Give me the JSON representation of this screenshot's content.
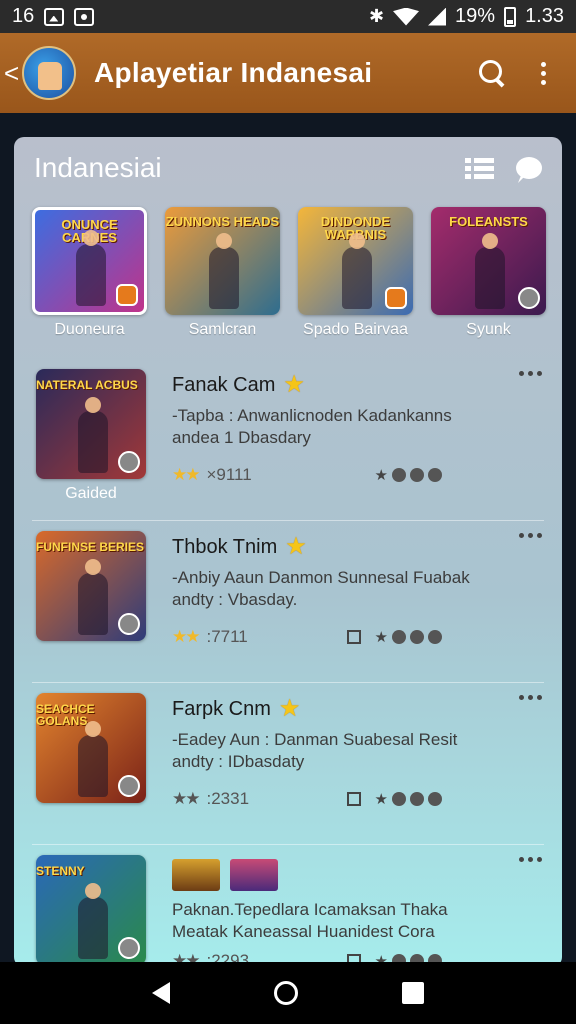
{
  "status_bar": {
    "time_left": "16",
    "battery_pct": "19%",
    "clock": "1.33"
  },
  "app_bar": {
    "back_glyph": "<",
    "title": "Aplayetiar Indanesai",
    "search_icon": "search-icon",
    "menu_icon": "more-vert-icon"
  },
  "section": {
    "title": "Indanesiai",
    "list_view_icon": "list-view-icon",
    "chat_icon": "chat-icon"
  },
  "featured": [
    {
      "label": "Duoneura",
      "thumb_title": "ONUNCE CARNES",
      "colors": [
        "#3d6de0",
        "#c0338a"
      ],
      "selected": true,
      "badge": "orange"
    },
    {
      "label": "Samlcran",
      "thumb_title": "ZUNNONS HEADS",
      "colors": [
        "#ec9b3b",
        "#2e6d8f"
      ],
      "selected": false,
      "badge": ""
    },
    {
      "label": "Spado Bairvaa",
      "thumb_title": "DINDONDE WARBNIS",
      "colors": [
        "#f4b63a",
        "#3b6bb3"
      ],
      "selected": false,
      "badge": "orange"
    },
    {
      "label": "Syunk",
      "thumb_title": "FOLEANSTS",
      "colors": [
        "#a42c6c",
        "#3b1a4e"
      ],
      "selected": false,
      "badge": "grey"
    }
  ],
  "items": [
    {
      "title": "Fanak Cam",
      "desc_line1": "-Tapba : Anwanlicnoden Kadankanns",
      "desc_line2": "andea 1 Dbasdary",
      "count": "×9111",
      "stars": "★★",
      "stars_style": "gold",
      "thumb_title": "NATERAL ACBUS",
      "caption": "Gaided",
      "colors": [
        "#2a2a5a",
        "#a23838"
      ],
      "checkbox": false
    },
    {
      "title": "Thbok Tnim",
      "desc_line1": "-Anbiy Aaun Danmon Sunnesal Fuabak",
      "desc_line2": "andty : Vbasday.",
      "count": ":7711",
      "stars": "★★",
      "stars_style": "gold",
      "thumb_title": "FUNFINSE BERIES",
      "caption": "",
      "colors": [
        "#d96a2a",
        "#2e3c7a"
      ],
      "checkbox": true
    },
    {
      "title": "Farpk Cnm",
      "desc_line1": "-Eadey Aun : Danman Suabesal Resit",
      "desc_line2": "andty : IDbasdaty",
      "count": ":2331",
      "stars": "★★",
      "stars_style": "grey",
      "thumb_title": "SEACHCE GOLANS",
      "caption": "",
      "colors": [
        "#e2842e",
        "#7a2218"
      ],
      "checkbox": true
    },
    {
      "title": "",
      "desc_line1": "Paknan.Tepedlara Icamaksan Thaka",
      "desc_line2": "Meatak Kaneassal Huanidest Cora",
      "count": ":2293",
      "stars": "★★",
      "stars_style": "grey",
      "thumb_title": "STENNY",
      "caption": "",
      "colors": [
        "#2a68b8",
        "#2a8a4a"
      ],
      "checkbox": true
    }
  ]
}
